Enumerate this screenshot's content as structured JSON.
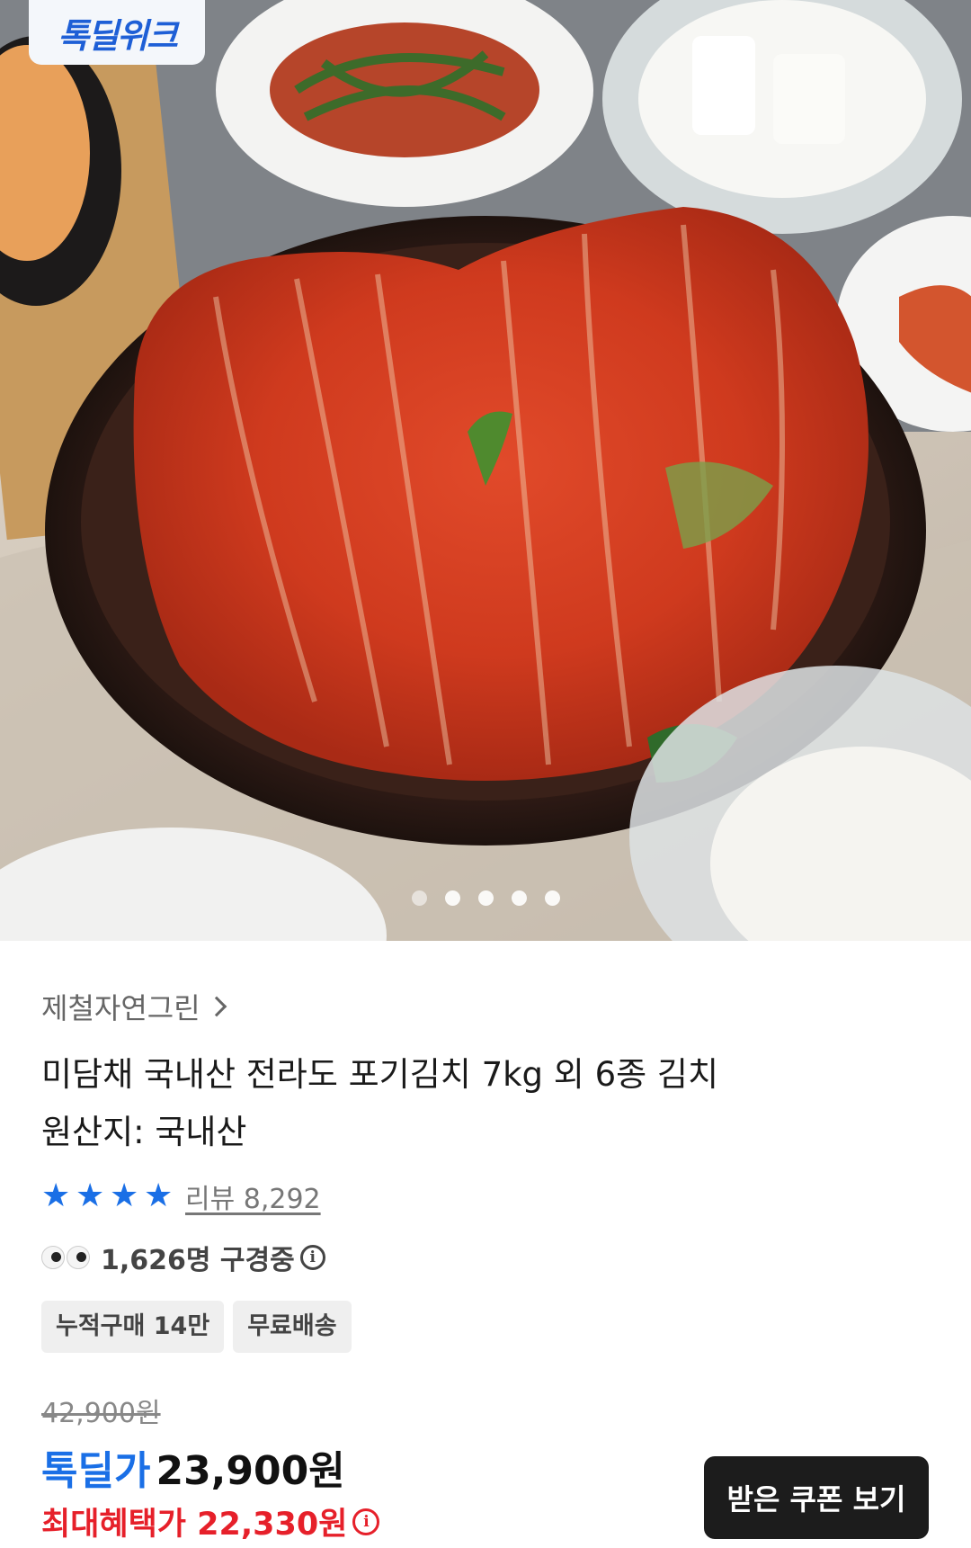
{
  "hero": {
    "badge": "톡딜위크",
    "image_alt": "kimchi-photo",
    "carousel_total": 5,
    "carousel_current": 1
  },
  "product": {
    "seller": "제철자연그린",
    "title": "미담채 국내산 전라도 포기김치 7kg 외 6종 김치",
    "origin": "원산지: 국내산",
    "rating_stars": 4,
    "review_label": "리뷰 8,292",
    "viewers_text": "1,626명 구경중",
    "tags": [
      "누적구매 14만",
      "무료배송"
    ]
  },
  "price": {
    "original": "42,900원",
    "deal_label": "톡딜가",
    "deal_price": "23,900원",
    "max_benefit": "최대혜택가 22,330원",
    "coupon_button": "받은 쿠폰 보기"
  },
  "colors": {
    "accent_blue": "#1a6fe6",
    "benefit_red": "#e6202a",
    "button_dark": "#1c1c1c"
  }
}
